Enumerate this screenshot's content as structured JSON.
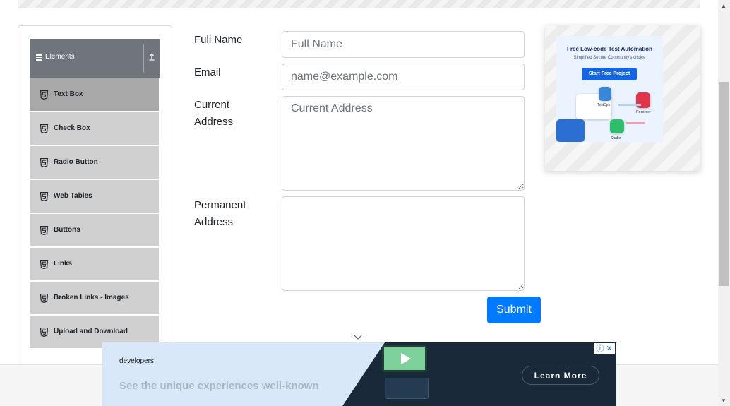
{
  "sidebar": {
    "header": {
      "title": "Elements"
    },
    "items": [
      {
        "label": "Text Box",
        "active": true
      },
      {
        "label": "Check Box",
        "active": false
      },
      {
        "label": "Radio Button",
        "active": false
      },
      {
        "label": "Web Tables",
        "active": false
      },
      {
        "label": "Buttons",
        "active": false
      },
      {
        "label": "Links",
        "active": false
      },
      {
        "label": "Broken Links - Images",
        "active": false
      },
      {
        "label": "Upload and Download",
        "active": false
      }
    ]
  },
  "form": {
    "full_name": {
      "label": "Full Name",
      "placeholder": "Full Name",
      "value": ""
    },
    "email": {
      "label": "Email",
      "placeholder": "name@example.com",
      "value": ""
    },
    "current_address": {
      "label_line1": "Current",
      "label_line2": "Address",
      "placeholder": "Current Address",
      "value": ""
    },
    "permanent_address": {
      "label_line1": "Permanent",
      "label_line2": "Address",
      "placeholder": "",
      "value": ""
    },
    "submit_label": "Submit"
  },
  "side_ad": {
    "title": "Free Low-code Test Automation",
    "subtitle": "Simplified Secure Community's choice",
    "button": "Start Free Project",
    "tags": [
      "TestOps",
      "Recorder",
      "Studio"
    ]
  },
  "bottom_ad": {
    "brand": "developers",
    "tagline": "See the unique experiences well-known",
    "cta": "Learn More",
    "adchoices": "ⓘ ✕"
  },
  "colors": {
    "primary": "#007bff",
    "sidebar_header": "#6f757b",
    "menu_item": "#d0d0d0",
    "menu_item_active": "#a8a8a8"
  }
}
